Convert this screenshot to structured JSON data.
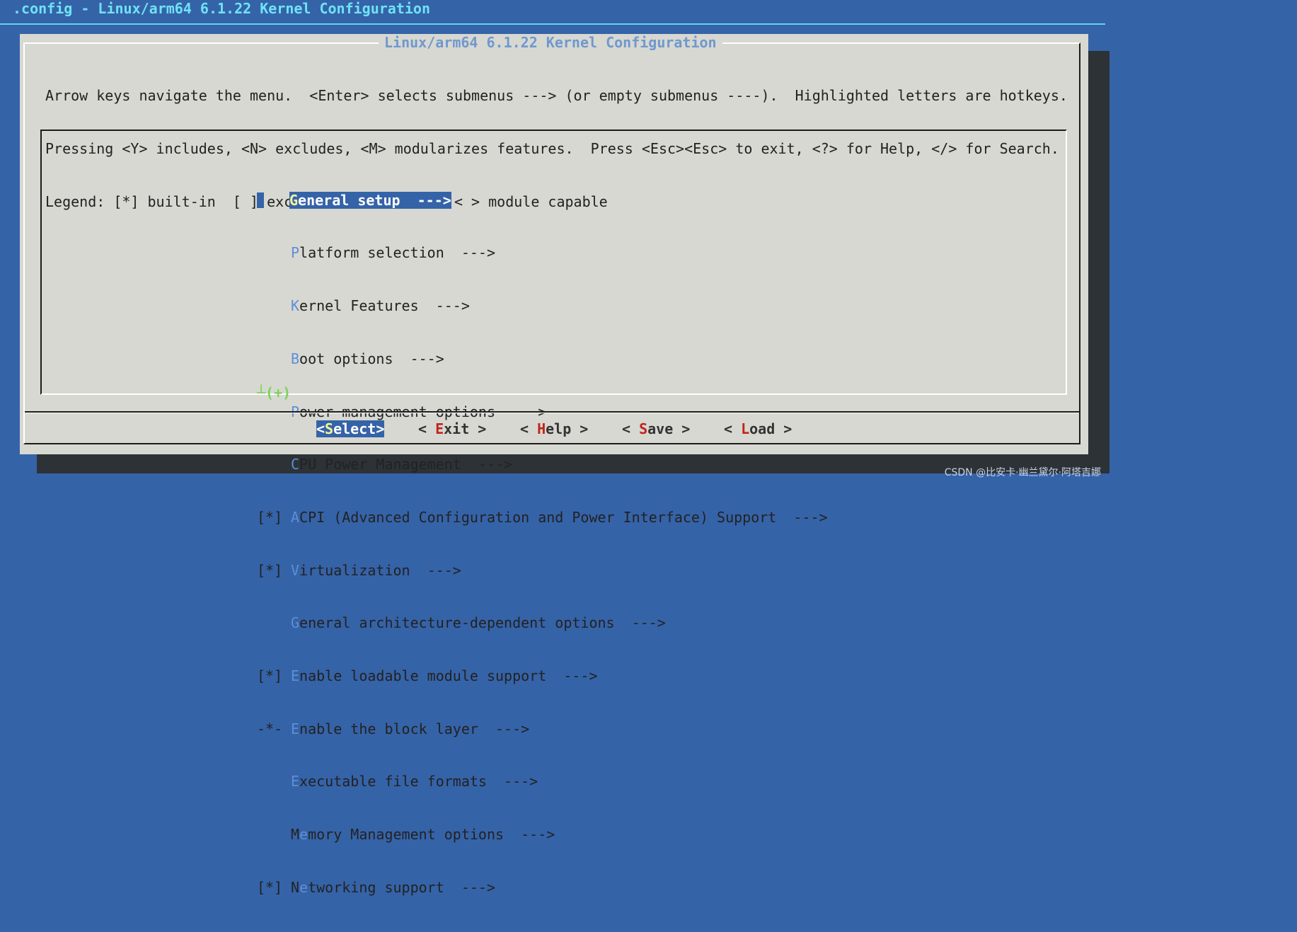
{
  "window": {
    "title": ".config - Linux/arm64 6.1.22 Kernel Configuration"
  },
  "dialog": {
    "title": "Linux/arm64 6.1.22 Kernel Configuration",
    "instructions": [
      "Arrow keys navigate the menu.  <Enter> selects submenus ---> (or empty submenus ----).  Highlighted letters are hotkeys.",
      "Pressing <Y> includes, <N> excludes, <M> modularizes features.  Press <Esc><Esc> to exit, <?> for Help, </> for Search.",
      "Legend: [*] built-in  [ ] excluded  <M> module  < > module capable"
    ]
  },
  "menu": {
    "items": [
      {
        "prefix": "",
        "hotkey": "G",
        "rest": "eneral setup  --->",
        "selected": true
      },
      {
        "prefix": "",
        "hotkey": "P",
        "rest": "latform selection  --->"
      },
      {
        "prefix": "",
        "hotkey": "K",
        "rest": "ernel Features  --->"
      },
      {
        "prefix": "",
        "hotkey": "B",
        "rest": "oot options  --->"
      },
      {
        "prefix": "",
        "hotkey": "P",
        "rest": "ower management options  --->"
      },
      {
        "prefix": "",
        "hotkey": "C",
        "rest": "PU Power Management  --->"
      },
      {
        "prefix": "[*]",
        "hotkey": "A",
        "rest": "CPI (Advanced Configuration and Power Interface) Support  --->"
      },
      {
        "prefix": "[*]",
        "hotkey": "V",
        "rest": "irtualization  --->"
      },
      {
        "prefix": "",
        "hotkey": "G",
        "rest": "eneral architecture-dependent options  --->"
      },
      {
        "prefix": "[*]",
        "hotkey": "E",
        "rest": "nable loadable module support  --->"
      },
      {
        "prefix": "-*-",
        "hotkey": "E",
        "rest": "nable the block layer  --->"
      },
      {
        "prefix": "",
        "hotkey": "E",
        "rest": "xecutable file formats  --->"
      },
      {
        "prefix": "",
        "before": "M",
        "hotkey": "e",
        "rest": "mory Management options  --->"
      },
      {
        "prefix": "[*]",
        "before": "N",
        "hotkey": "e",
        "rest": "tworking support  --->"
      }
    ],
    "more_indicator": "┴(+)"
  },
  "buttons": {
    "select": {
      "open": "<",
      "hotkey": "S",
      "rest": "elect",
      "close": ">"
    },
    "exit": {
      "open": "< ",
      "hotkey": "E",
      "rest": "xit",
      "close": " >"
    },
    "help": {
      "open": "< ",
      "hotkey": "H",
      "rest": "elp",
      "close": " >"
    },
    "save": {
      "open": "< ",
      "hotkey": "S",
      "rest": "ave",
      "close": " >"
    },
    "load": {
      "open": "< ",
      "hotkey": "L",
      "rest": "oad",
      "close": " >"
    }
  },
  "watermark": "CSDN @比安卡·幽兰黛尔·阿塔吉娜",
  "colors": {
    "background": "#3563a8",
    "dialog": "#d7d8d1",
    "title_text": "#6fe3f5",
    "hotkey": "#5f8ed6",
    "button_hotkey": "#c0241c",
    "selection": "#3563a8",
    "more_indicator": "#7bd35a"
  }
}
